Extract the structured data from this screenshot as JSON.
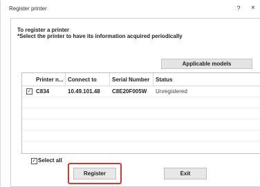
{
  "window": {
    "title": "Register printer",
    "help_label": "?",
    "close_label": "×"
  },
  "instructions": {
    "line1": "To register a printer",
    "line2": "*Select the printer to have its information acquired periodically"
  },
  "applicable_models_label": "Applicable models",
  "table": {
    "columns": [
      "Printer n...",
      "Connect to",
      "Serial Number",
      "Status"
    ],
    "rows": [
      {
        "checked": true,
        "printer_name": "C834",
        "connect_to": "10.49.101.48",
        "serial_number": "C8E20F005W",
        "status": "Unregistered"
      }
    ]
  },
  "select_all": {
    "label": "Select all",
    "checked": true
  },
  "buttons": {
    "register": "Register",
    "exit": "Exit"
  },
  "colors": {
    "highlight": "#e0342f"
  }
}
